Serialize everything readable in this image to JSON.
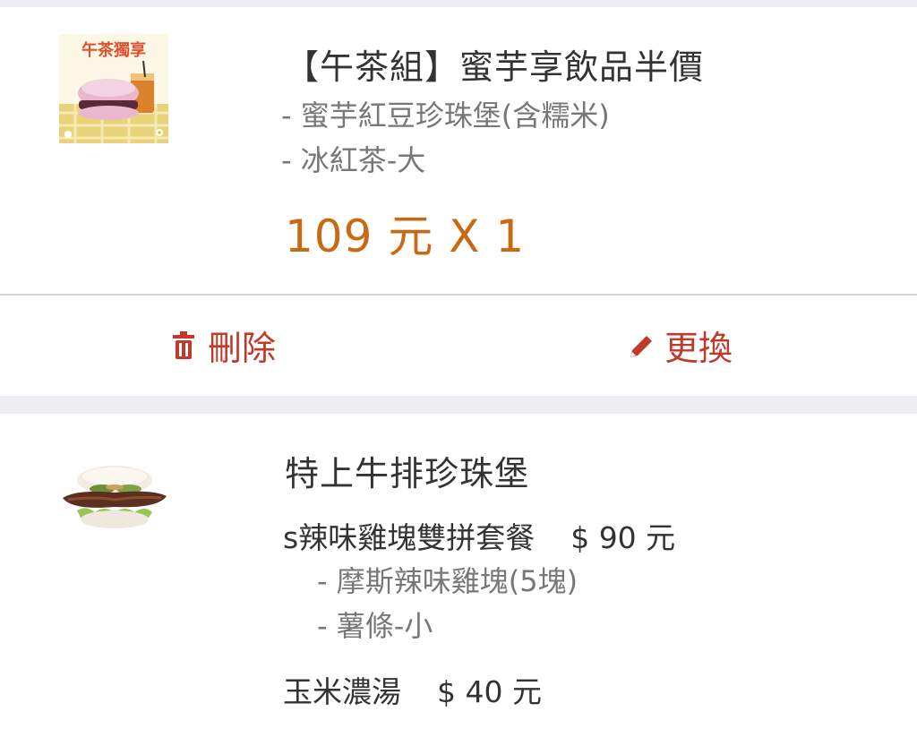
{
  "colors": {
    "price": "#c86a14",
    "action": "#c0392b",
    "title": "#333333",
    "sub": "#777777",
    "divider": "#d4d4d8",
    "background": "#eeeef2"
  },
  "items": [
    {
      "image_label": "午茶獨享",
      "title": "【午茶組】蜜芋享飲品半價",
      "subs": [
        "- 蜜芋紅豆珍珠堡(含糯米)",
        "- 冰紅茶-大"
      ],
      "price": "109 元 X 1",
      "actions": {
        "delete": {
          "icon": "trash-icon",
          "label": "刪除"
        },
        "change": {
          "icon": "pencil-icon",
          "label": "更換"
        }
      }
    },
    {
      "image_icon": "steak-burger-image",
      "title": "特上牛排珍珠堡",
      "options": [
        {
          "name": "s辣味雞塊雙拼套餐",
          "price": "$ 90 元",
          "subs": [
            "- 摩斯辣味雞塊(5塊)",
            "- 薯條-小"
          ]
        },
        {
          "name": "玉米濃湯",
          "price": "$ 40 元",
          "subs": []
        }
      ]
    }
  ]
}
